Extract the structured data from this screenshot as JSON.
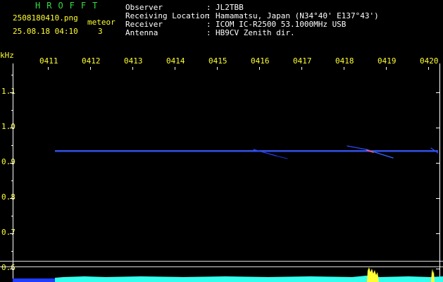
{
  "header": {
    "app_title": "HROFFT",
    "filename": "2508180410.png",
    "datetime": "25.08.18 04:10",
    "meteor_label": "meteor",
    "meteor_count": "3",
    "meta": [
      {
        "label": "Observer",
        "value": "JL2TBB"
      },
      {
        "label": "Receiving Location",
        "value": "Hamamatsu, Japan (N34°40' E137°43')"
      },
      {
        "label": "Receiver",
        "value": "ICOM IC-R2500 53.1000MHz USB"
      },
      {
        "label": "Antenna",
        "value": "HB9CV Zenith dir."
      }
    ]
  },
  "spectrogram": {
    "unit": "kHz",
    "time_ticks": [
      "0411",
      "0412",
      "0413",
      "0414",
      "0415",
      "0416",
      "0417",
      "0418",
      "0419",
      "0420"
    ],
    "freq_ticks": [
      "1.1",
      "1.0",
      "0.9",
      "0.8",
      "0.7",
      "0.6"
    ],
    "carrier_khz": 0.93,
    "colors": {
      "text": "#ffffff",
      "accent": "#ffff33",
      "title": "#33dd44",
      "carrier": "#3355ff",
      "level": "#33ffee",
      "spike": "#ffff33"
    }
  }
}
